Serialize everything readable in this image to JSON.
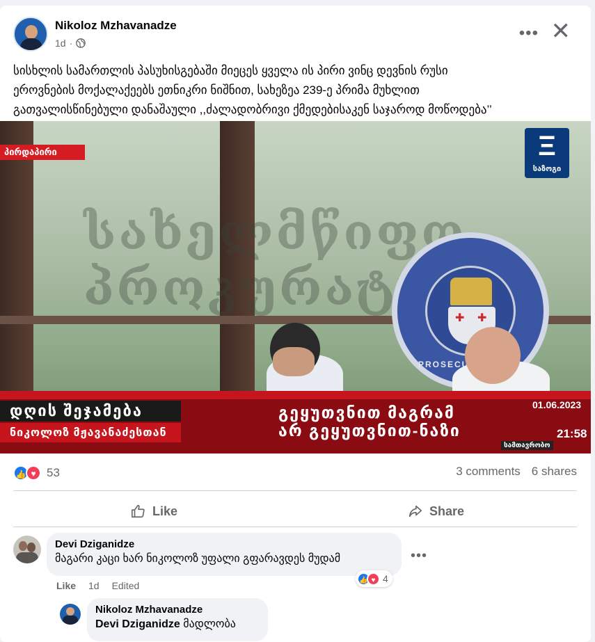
{
  "post": {
    "author": "Nikoloz Mzhavanadze",
    "time": "1d",
    "text": "სისხლის სამართლის პასუხისგებაში მიეცეს ყველა ის პირი ვინც  დევნის რუსი\nეროვნების მოქალაქეებს ეთნიკრი ნიშნით, სახეზეა 239-ე პრიმა მუხლით\nგათვალისწინებული დანაშაული ,,ძალადობრივი ქმედებისაკენ საჯაროდ მოწოდება’’",
    "more_icon": "more-horizontal-icon",
    "close_icon": "close-icon",
    "privacy_icon": "globe-icon"
  },
  "video": {
    "channel_logo_text": "საზოგი",
    "live_label": "პირდაპირი",
    "wall_text": "სახელმწიფო პროკურატურა",
    "seal_text": "PROSECUTION",
    "ticker_show": "დღის",
    "ticker_show2": "შეჯამება",
    "ticker_guest": "ნიკოლოზ მჟავანაძესთან",
    "headline_line1": "გეყუთვნით მაგრამ",
    "headline_line2": "არ გეყუთვნით-ნაზი",
    "date": "01.06.2023",
    "clock": "21:58",
    "sub_label": "სამთავრობო"
  },
  "engagement": {
    "reaction_count": "53",
    "comments": "3 comments",
    "shares": "6 shares",
    "like_label": "Like",
    "share_label": "Share"
  },
  "comments": [
    {
      "author": "Devi Dziganidze",
      "text": "მაგარი კაცი ხარ ნიკოლოზ უფალი გფარავდეს მუდამ",
      "like": "Like",
      "time": "1d",
      "edited": "Edited",
      "reactions": "4"
    },
    {
      "author": "Nikoloz Mzhavanadze",
      "mention": "Devi Dziganidze",
      "text": " მადლობა"
    }
  ],
  "colors": {
    "accent": "#1877f2",
    "love": "#f33e58",
    "ticker_red": "#c7151d"
  }
}
